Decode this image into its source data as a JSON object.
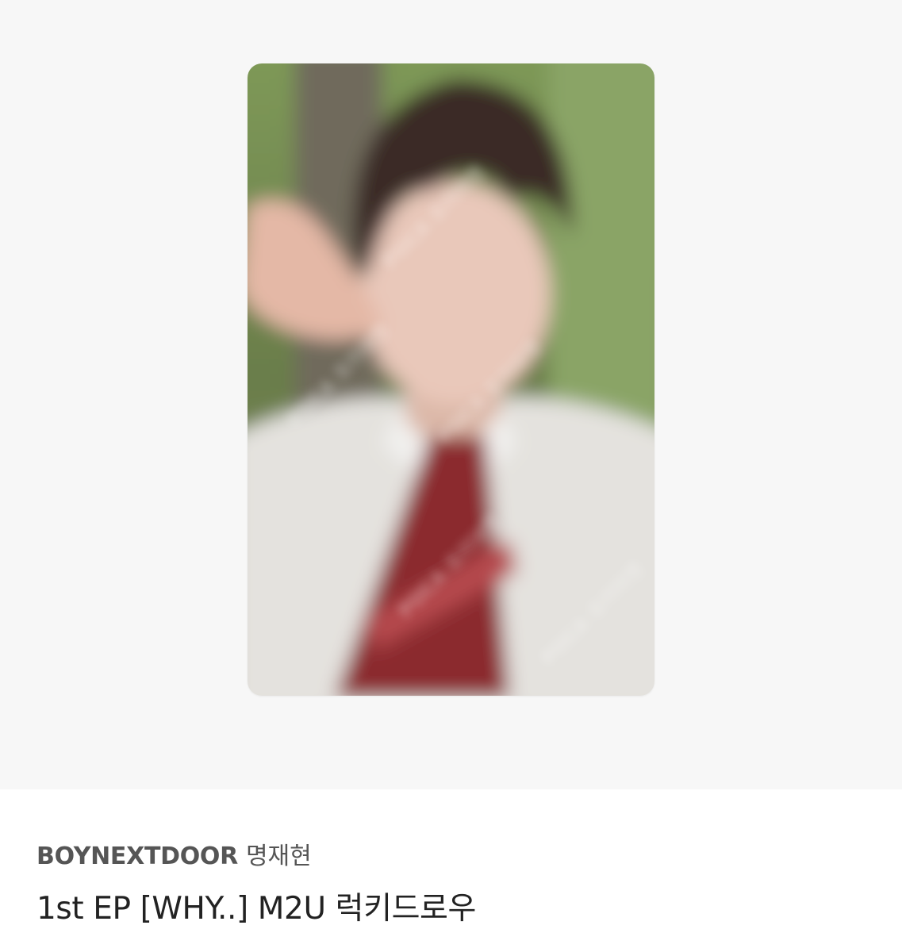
{
  "product": {
    "group": "BOYNEXTDOOR",
    "member": "명재현",
    "title": "1st EP [WHY..] M2U 럭키드로우"
  },
  "photo": {
    "watermark": "POCA 포카마켓",
    "colors": {
      "background": "#f7f7f7",
      "foliage": "#6e8a4c",
      "shirt": "#e9e8e6",
      "tie": "#8a2a2e",
      "hair": "#3a2a26",
      "skin": "#e6c3b4"
    }
  }
}
